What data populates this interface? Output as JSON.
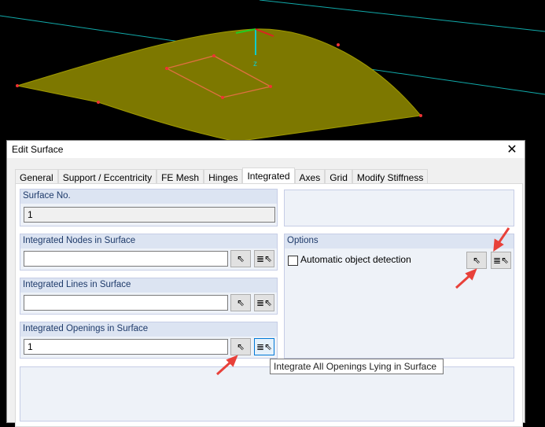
{
  "dialog": {
    "title": "Edit Surface",
    "close_label": "✕"
  },
  "tabs": [
    "General",
    "Support / Eccentricity",
    "FE Mesh",
    "Hinges",
    "Integrated",
    "Axes",
    "Grid",
    "Modify Stiffness"
  ],
  "active_tab": "Integrated",
  "surface_no": {
    "label": "Surface No.",
    "value": "1"
  },
  "nodes": {
    "label": "Integrated Nodes in Surface",
    "value": ""
  },
  "lines": {
    "label": "Integrated Lines in Surface",
    "value": ""
  },
  "openings": {
    "label": "Integrated Openings in Surface",
    "value": "1"
  },
  "options": {
    "label": "Options",
    "auto_detect_label": "Automatic object detection",
    "auto_detect_checked": false
  },
  "tooltip": "Integrate All Openings Lying in Surface",
  "colors": {
    "surface": "#807a00",
    "annotation_arrow": "#e8413a",
    "group_header": "#dce4f2"
  }
}
